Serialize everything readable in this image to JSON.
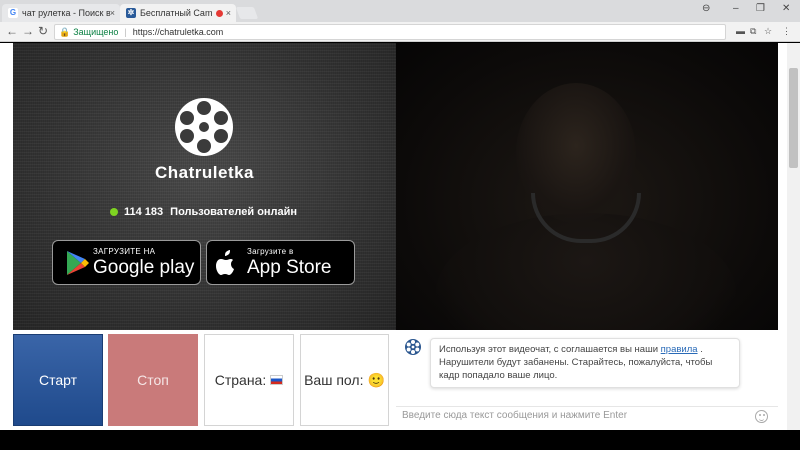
{
  "browser": {
    "tabs": [
      {
        "title": "чат рулетка - Поиск в Go",
        "favicon": "google-favicon"
      },
      {
        "title": "Бесплатный Cam Chat",
        "favicon": "chatruletka-favicon",
        "recording": true
      }
    ],
    "close_glyph": "×",
    "window_controls": [
      "⊖",
      "–",
      "❐",
      "✕"
    ],
    "nav": {
      "back": "←",
      "forward": "→",
      "reload": "↻"
    },
    "address": {
      "secure_label": "Защищено",
      "url": "https://chatruletka.com"
    },
    "extensions": [
      "▬",
      "⧉",
      "☆",
      "⋮"
    ]
  },
  "brand": {
    "name": "Chatruletka"
  },
  "online": {
    "count": "114 183",
    "label": "Пользователей онлайн",
    "dot_color": "#7ed321"
  },
  "stores": {
    "google": {
      "small": "ЗАГРУЗИТЕ НА",
      "big": "Google play"
    },
    "apple": {
      "small": "Загрузите в",
      "big": "App Store"
    }
  },
  "controls": {
    "start": "Старт",
    "stop": "Стоп",
    "country_label": "Страна:",
    "gender_label": "Ваш пол:",
    "gender_emoji": "🙂"
  },
  "chat": {
    "notice_before": "Используя этот видеочат, с соглашается вы наши ",
    "rules_link": "правила",
    "notice_after": " . Нарушители будут забанены. Старайтесь, пожалуйста, чтобы кадр попадало ваше лицо.",
    "input_placeholder": "Введите сюда текст сообщения и нажмите Enter"
  },
  "colors": {
    "start_button": "#2a568f",
    "stop_button": "#c97a7a",
    "accent_link": "#2a6bb8"
  }
}
